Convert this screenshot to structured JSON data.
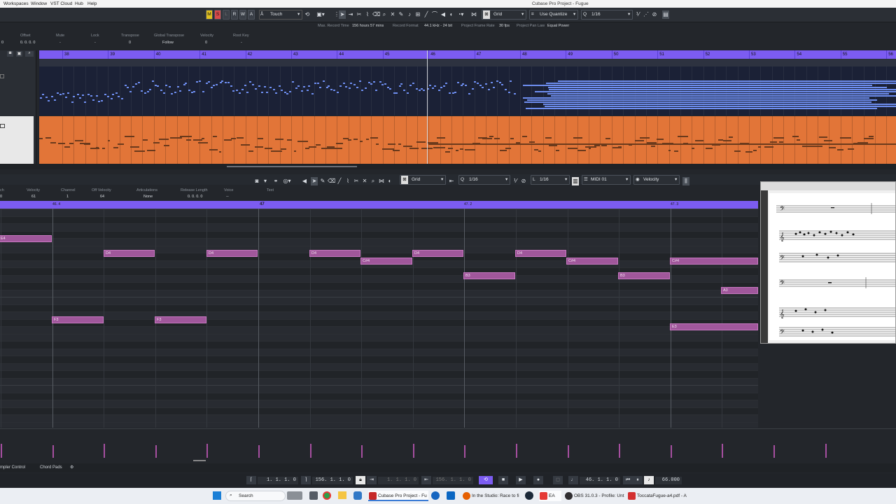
{
  "menubar": {
    "items": [
      "Workspaces",
      "Window",
      "VST Cloud",
      "Hub",
      "Help"
    ],
    "window_title": "Cubase Pro Project - Fugue"
  },
  "toolbar": {
    "modes": [
      "M",
      "S",
      "L",
      "R",
      "W",
      "A"
    ],
    "automation_mode": "Touch",
    "snap_type": "Grid",
    "quantize_preset": "Use Quantize",
    "quantize_value": "1/16"
  },
  "status": {
    "max_record_time_label": "Max. Record Time",
    "max_record_time": "156 hours 57 mins",
    "record_format_label": "Record Format",
    "record_format": "44.1 kHz - 24 bit",
    "frame_rate_label": "Project Frame Rate",
    "frame_rate": "30 fps",
    "pan_law_label": "Project Pan Law",
    "pan_law": "Equal Power"
  },
  "arrange_info": {
    "headers": [
      "Offset",
      "Mute",
      "Lock",
      "Transpose",
      "Global Transpose",
      "Velocity",
      "Root Key"
    ],
    "values": [
      "0. 0. 0. 0",
      "-",
      "-",
      "0",
      "Follow",
      "0",
      "-"
    ],
    "left_value": "0"
  },
  "arrange_ruler": [
    "38",
    "39",
    "40",
    "41",
    "42",
    "43",
    "44",
    "45",
    "46",
    "47",
    "48",
    "49",
    "50",
    "51",
    "52",
    "53",
    "54",
    "55",
    "56"
  ],
  "editor_toolbar": {
    "snap_type": "Grid",
    "quantize": "1/16",
    "length": "1/16",
    "midi_channel": "MIDI 01",
    "controller": "Velocity"
  },
  "editor_info": {
    "headers": [
      "ch",
      "Velocity",
      "Channel",
      "Off Velocity",
      "Articulations",
      "Release Length",
      "Voice",
      "Text"
    ],
    "values": [
      "0",
      "61",
      "1",
      "64",
      "None",
      "0. 0. 0. 0",
      "--",
      ""
    ]
  },
  "editor_ruler": [
    "46. 4",
    "47",
    "47. 2",
    "47. 3"
  ],
  "notes": [
    {
      "label": "E4",
      "row": 4,
      "start": -2,
      "end": 74
    },
    {
      "label": "D4",
      "row": 6,
      "start": 148,
      "end": 221
    },
    {
      "label": "D4",
      "row": 6,
      "start": 295,
      "end": 368
    },
    {
      "label": "D4",
      "row": 6,
      "start": 442,
      "end": 515
    },
    {
      "label": "D4",
      "row": 6,
      "start": 589,
      "end": 662
    },
    {
      "label": "D4",
      "row": 6,
      "start": 736,
      "end": 809
    },
    {
      "label": "C#4",
      "row": 7,
      "start": 515,
      "end": 589
    },
    {
      "label": "C#4",
      "row": 7,
      "start": 809,
      "end": 883
    },
    {
      "label": "C#4",
      "row": 7,
      "start": 957,
      "end": 1083
    },
    {
      "label": "B3",
      "row": 9,
      "start": 662,
      "end": 736
    },
    {
      "label": "B3",
      "row": 9,
      "start": 883,
      "end": 957
    },
    {
      "label": "A3",
      "row": 11,
      "start": 1030,
      "end": 1083
    },
    {
      "label": "F3",
      "row": 15,
      "start": 74,
      "end": 148
    },
    {
      "label": "F3",
      "row": 15,
      "start": 221,
      "end": 295
    },
    {
      "label": "E3",
      "row": 16,
      "start": 957,
      "end": 1083
    }
  ],
  "bottom_tabs": [
    "mpler Control",
    "Chord Pads"
  ],
  "transport": {
    "left_locator": "1. 1. 1. 0",
    "right_locator": "156. 1. 1. 0",
    "punch_in": "1. 1. 1. 0",
    "punch_out": "156. 1. 1. 0",
    "position": "46. 1. 1. 0",
    "tempo": "66.000"
  },
  "taskbar": {
    "search": "Search",
    "tasks": [
      "Cubase Pro Project - Fu",
      "In the Studio: Race to fi",
      "EA",
      "OBS 31.0.3 - Profile: Unt",
      "ToccataFugue-a4.pdf - A"
    ]
  },
  "colors": {
    "ruler": "#7c5cf1",
    "midi_part_blue": "#1b2136",
    "midi_part_orange": "#e27538",
    "note": "#a0579b"
  }
}
